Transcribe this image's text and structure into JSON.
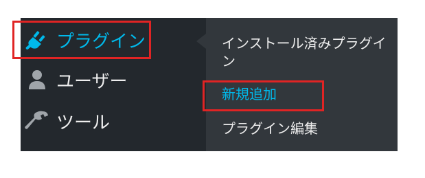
{
  "menu": {
    "items": [
      {
        "label": "プラグイン",
        "icon": "plug-icon",
        "active": true
      },
      {
        "label": "ユーザー",
        "icon": "user-icon",
        "active": false
      },
      {
        "label": "ツール",
        "icon": "wrench-icon",
        "active": false
      }
    ]
  },
  "submenu": {
    "items": [
      {
        "label": "インストール済みプラグイン",
        "active": false
      },
      {
        "label": "新規追加",
        "active": true
      },
      {
        "label": "プラグイン編集",
        "active": false
      }
    ]
  },
  "colors": {
    "menu_bg": "#23282d",
    "submenu_bg": "#32373c",
    "active_text": "#00b9eb",
    "text": "#eeeeee",
    "highlight": "#e02424"
  }
}
